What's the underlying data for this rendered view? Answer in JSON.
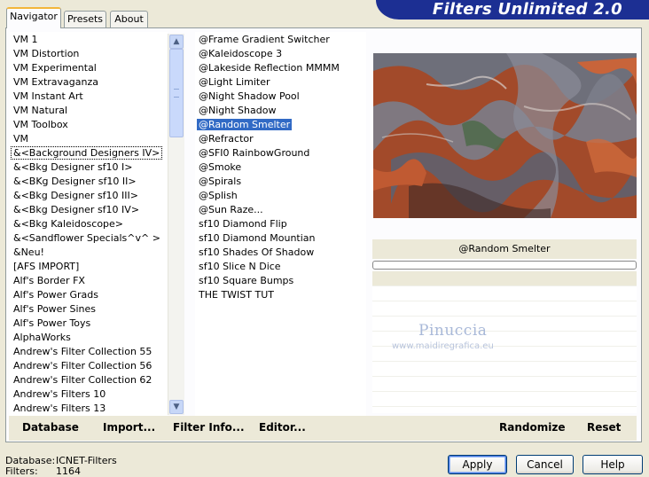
{
  "window": {
    "banner_title": "Filters Unlimited 2.0"
  },
  "tabs": [
    {
      "label": "Navigator",
      "active": true
    },
    {
      "label": "Presets",
      "active": false
    },
    {
      "label": "About",
      "active": false
    }
  ],
  "categories": [
    "VM 1",
    "VM Distortion",
    "VM Experimental",
    "VM Extravaganza",
    "VM Instant Art",
    "VM Natural",
    "VM Toolbox",
    "VM",
    "&<Background Designers IV>",
    "&<Bkg Designer sf10 I>",
    "&<BKg Designer sf10 II>",
    "&<Bkg Designer sf10 III>",
    "&<Bkg Designer sf10 IV>",
    "&<Bkg Kaleidoscope>",
    "&<Sandflower Specials^v^ >",
    "&Neu!",
    "[AFS IMPORT]",
    "Alf's Border FX",
    "Alf's Power Grads",
    "Alf's Power Sines",
    "Alf's Power Toys",
    "AlphaWorks",
    "Andrew's Filter Collection 55",
    "Andrew's Filter Collection 56",
    "Andrew's Filter Collection 62",
    "Andrew's Filters 10",
    "Andrew's Filters 13"
  ],
  "selected_category_index": 8,
  "filters": [
    "@Frame Gradient Switcher",
    "@Kaleidoscope 3",
    "@Lakeside Reflection MMMM",
    "@Light Limiter",
    "@Night Shadow Pool",
    "@Night Shadow",
    "@Random Smelter",
    "@Refractor",
    "@SFI0 RainbowGround",
    "@Smoke",
    "@Spirals",
    "@Splish",
    "@Sun Raze...",
    "sf10 Diamond Flip",
    "sf10 Diamond Mountian",
    "sf10 Shades Of Shadow",
    "sf10 Slice N Dice",
    "sf10 Square Bumps",
    "THE TWIST TUT"
  ],
  "selected_filter_index": 6,
  "preview": {
    "filter_name": "@Random Smelter",
    "progress": 0
  },
  "watermark": {
    "name": "Pinuccia",
    "site": "www.maidiregrafica.eu"
  },
  "toolbar": {
    "database_label": "Database",
    "import_label": "Import...",
    "filter_info_label": "Filter Info...",
    "editor_label": "Editor...",
    "randomize_label": "Randomize",
    "reset_label": "Reset"
  },
  "status": {
    "database_label": "Database:",
    "database_value": "ICNET-Filters",
    "filters_label": "Filters:",
    "filters_value": "1164"
  },
  "buttons": {
    "apply_label": "Apply",
    "cancel_label": "Cancel",
    "help_label": "Help"
  },
  "colors": {
    "banner": "#1c2f93",
    "selection": "#316ac5",
    "window_bg": "#ece9d8"
  }
}
